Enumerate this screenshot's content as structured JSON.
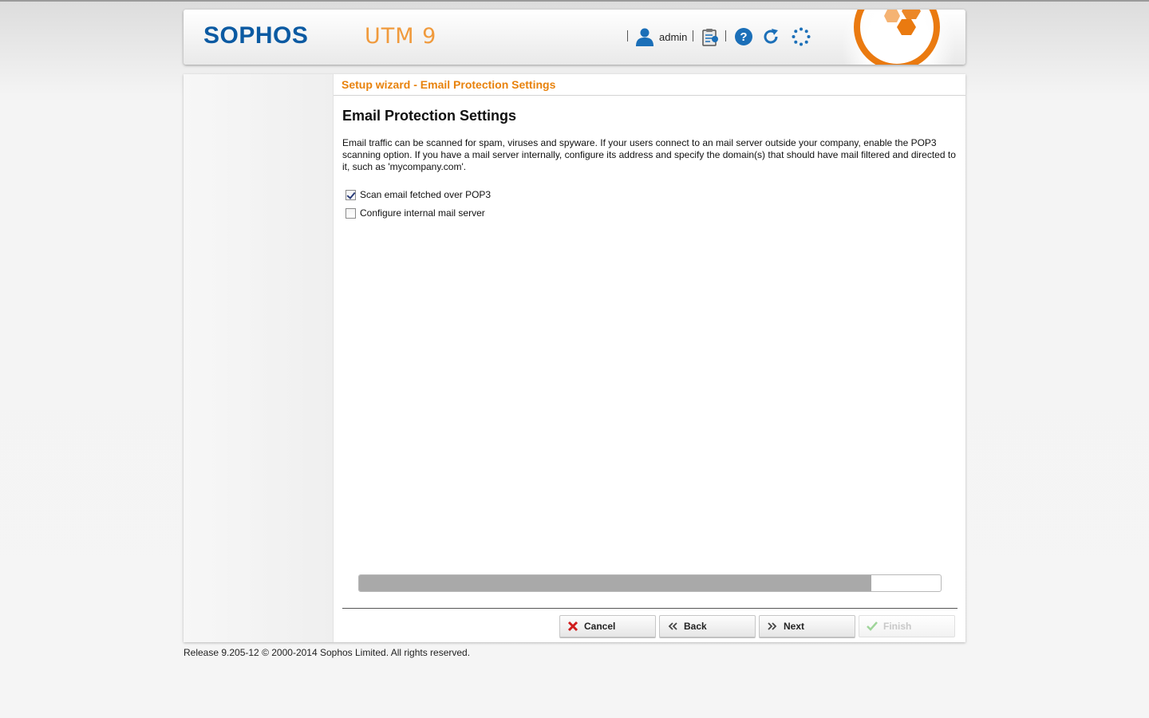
{
  "header": {
    "brand": "SOPHOS",
    "product": "UTM 9",
    "user_name": "admin",
    "icons": [
      "user-icon",
      "clipboard-icon",
      "help-icon",
      "reload-icon",
      "activity-spinner-icon"
    ],
    "emblem": "sophos-orange-emblem"
  },
  "wizard": {
    "title": "Setup wizard - Email Protection Settings",
    "heading": "Email Protection Settings",
    "description": "Email traffic can be scanned for spam, viruses and spyware. If your users connect to an mail server outside your company, enable the POP3 scanning option. If you have a mail server internally, configure its address and specify the domain(s) that should have mail filtered and directed to it, such as 'mycompany.com'.",
    "options": [
      {
        "label": "Scan email fetched over POP3",
        "checked": true
      },
      {
        "label": "Configure internal mail server",
        "checked": false
      }
    ],
    "progress_fraction": 0.88
  },
  "buttons": {
    "cancel": "Cancel",
    "back": "Back",
    "next": "Next",
    "finish": "Finish"
  },
  "colors": {
    "brand_blue": "#0b5aa2",
    "accent_orange": "#e8820c",
    "progress_fill": "#a9a9a9"
  },
  "footer": {
    "release": "Release 9.205-12",
    "copyright": "© 2000-2014 Sophos Limited. All rights reserved."
  }
}
